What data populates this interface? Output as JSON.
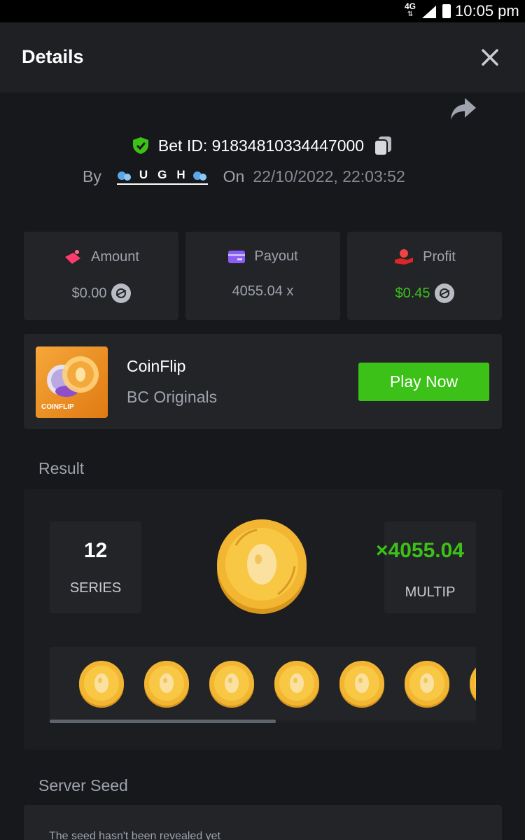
{
  "status_bar": {
    "network": "4G",
    "network_arrows": "⇅",
    "time": "10:05 pm"
  },
  "header": {
    "title": "Details",
    "close_icon": "close-icon"
  },
  "bet": {
    "id_text": "Bet ID: 91834810334447000",
    "by_label": "By",
    "username": "UGH",
    "on_label": "On",
    "datetime": "22/10/2022, 22:03:52"
  },
  "stats": {
    "amount": {
      "label": "Amount",
      "value": "$0.00",
      "icon": "money-wings-icon"
    },
    "payout": {
      "label": "Payout",
      "value": "4055.04 x",
      "icon": "card-icon"
    },
    "profit": {
      "label": "Profit",
      "value": "$0.45",
      "icon": "hand-coin-icon"
    }
  },
  "game": {
    "name": "CoinFlip",
    "provider": "BC Originals",
    "thumb_label": "COINFLIP",
    "play_label": "Play Now"
  },
  "result": {
    "section_title": "Result",
    "series_value": "12",
    "series_label": "SERIES",
    "multiplier_value": "×4055.04",
    "multiplier_label": "MULTIP"
  },
  "server_seed": {
    "section_title": "Server Seed",
    "text": "The seed hasn't been revealed yet"
  },
  "colors": {
    "accent_green": "#3bc117",
    "background": "#17181b",
    "card": "#232428"
  }
}
